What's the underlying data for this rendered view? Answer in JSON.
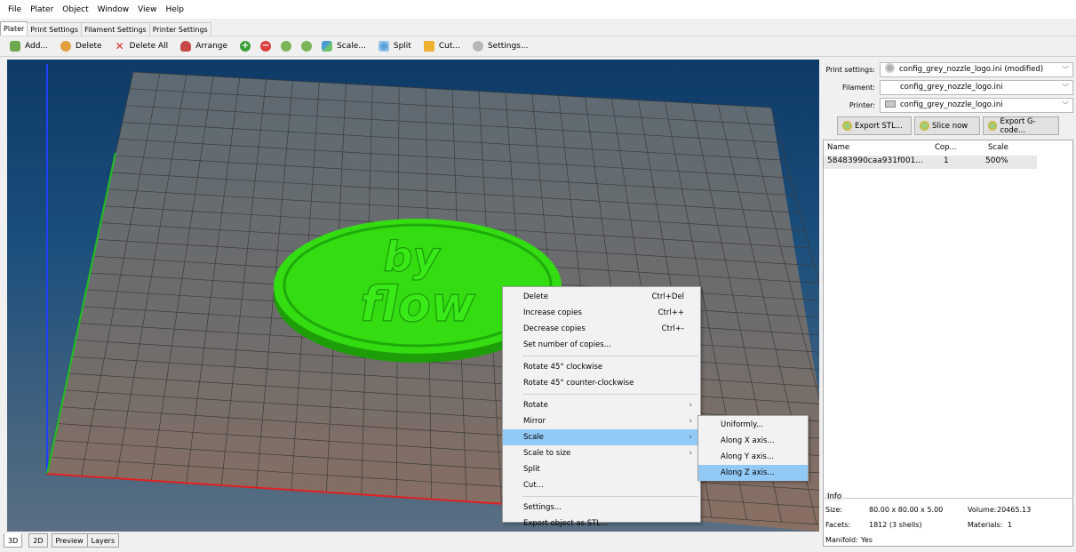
{
  "menu": [
    "File",
    "Plater",
    "Object",
    "Window",
    "View",
    "Help"
  ],
  "top_tabs": [
    "Plater",
    "Print Settings",
    "Filament Settings",
    "Printer Settings"
  ],
  "toolbar": {
    "add": "Add...",
    "delete": "Delete",
    "delete_all": "Delete All",
    "arrange": "Arrange",
    "scale": "Scale...",
    "split": "Split",
    "cut": "Cut...",
    "settings": "Settings..."
  },
  "settings_panel": {
    "print_label": "Print settings:",
    "print_value": "config_grey_nozzle_logo.ini (modified)",
    "filament_label": "Filament:",
    "filament_value": "config_grey_nozzle_logo.ini",
    "printer_label": "Printer:",
    "printer_value": "config_grey_nozzle_logo.ini",
    "export_stl": "Export STL...",
    "slice_now": "Slice now",
    "export_gcode": "Export G-code..."
  },
  "object_list": {
    "headers": [
      "Name",
      "Cop...",
      "Scale"
    ],
    "rows": [
      {
        "name": "58483990caa931f001...",
        "copies": "1",
        "scale": "500%"
      }
    ]
  },
  "context_menu": {
    "items": [
      {
        "label": "Delete",
        "shortcut": "Ctrl+Del"
      },
      {
        "label": "Increase copies",
        "shortcut": "Ctrl++"
      },
      {
        "label": "Decrease copies",
        "shortcut": "Ctrl+-"
      },
      {
        "label": "Set number of copies...",
        "shortcut": ""
      },
      {
        "label": "Rotate 45° clockwise",
        "shortcut": ""
      },
      {
        "label": "Rotate 45° counter-clockwise",
        "shortcut": ""
      },
      {
        "label": "Rotate",
        "shortcut": ""
      },
      {
        "label": "Mirror",
        "shortcut": ""
      },
      {
        "label": "Scale",
        "shortcut": ""
      },
      {
        "label": "Scale to size",
        "shortcut": ""
      },
      {
        "label": "Split",
        "shortcut": ""
      },
      {
        "label": "Cut...",
        "shortcut": ""
      },
      {
        "label": "Settings...",
        "shortcut": ""
      },
      {
        "label": "Export object as STL...",
        "shortcut": ""
      }
    ],
    "highlighted": "Scale"
  },
  "scale_submenu": {
    "items": [
      "Uniformly...",
      "Along X axis...",
      "Along Y axis...",
      "Along Z axis..."
    ],
    "highlighted": "Along Z axis..."
  },
  "model_text": [
    "by",
    "flow"
  ],
  "info": {
    "title": "Info",
    "size_label": "Size:",
    "size_value": "80.00 x 80.00 x 5.00",
    "volume_label": "Volume:",
    "volume_value": "20465.13",
    "facets_label": "Facets:",
    "facets_value": "1812 (3 shells)",
    "materials_label": "Materials:",
    "materials_value": "1",
    "manifold_label": "Manifold:",
    "manifold_value": "Yes"
  },
  "bottom_tabs": [
    "3D",
    "2D",
    "Preview",
    "Layers"
  ],
  "colors": {
    "model_green": "#33dd11",
    "axis_x": "#e02020",
    "axis_y": "#20c020",
    "axis_z": "#2040ff",
    "menu_highlight": "#91c9f7"
  }
}
